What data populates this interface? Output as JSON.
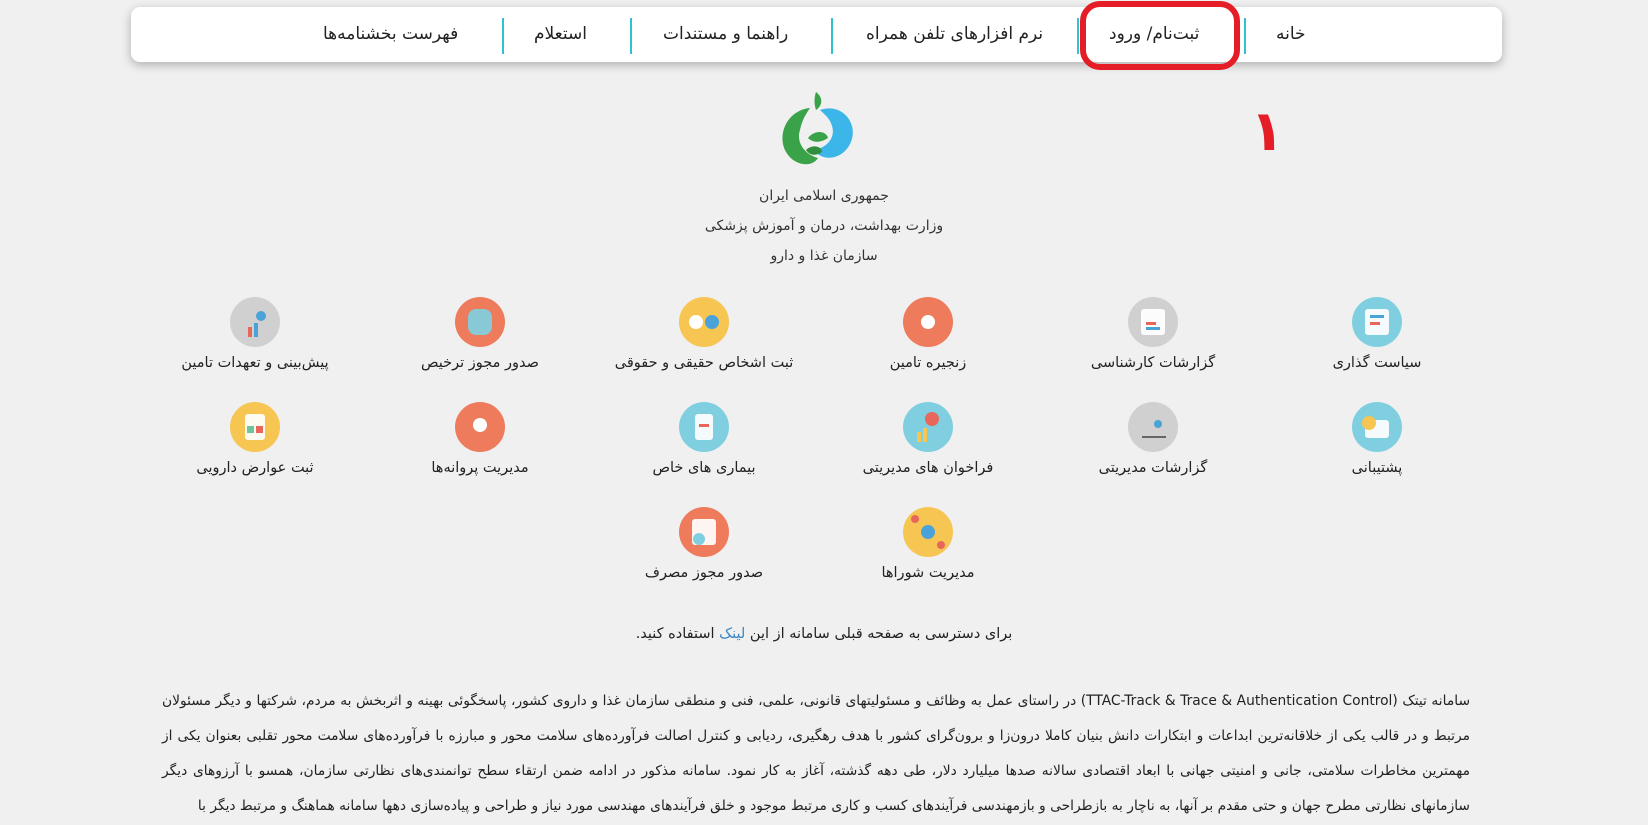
{
  "nav": {
    "items": [
      {
        "label": "خانه"
      },
      {
        "label": "ثبت‌نام/ ورود"
      },
      {
        "label": "نرم افزارهای تلفن همراه"
      },
      {
        "label": "راهنما و مستندات"
      },
      {
        "label": "استعلام"
      },
      {
        "label": "فهرست بخشنامه‌ها"
      }
    ]
  },
  "annotation": {
    "step_number": "۱",
    "color": "#e41d27"
  },
  "header": {
    "line1": "جمهوری اسلامی ایران",
    "line2": "وزارت بهداشت، درمان و آموزش پزشکی",
    "line3": "سازمان غذا و دارو"
  },
  "services": [
    {
      "label": "سیاست گذاری",
      "color": "#7fcfe0",
      "icon": "policy-icon"
    },
    {
      "label": "گزارشات کارشناسی",
      "color": "#d0d0d0",
      "icon": "expert-report-icon"
    },
    {
      "label": "زنجیره تامین",
      "color": "#ee7b5b",
      "icon": "supply-chain-icon"
    },
    {
      "label": "ثبت اشخاص حقیقی و حقوقی",
      "color": "#f6c552",
      "icon": "people-registration-icon"
    },
    {
      "label": "صدور مجوز ترخیص",
      "color": "#ee7b5b",
      "icon": "clearance-permit-icon"
    },
    {
      "label": "پیش‌بینی و تعهدات تامین",
      "color": "#d0d0d0",
      "icon": "forecast-icon"
    },
    {
      "label": "پشتیبانی",
      "color": "#7fcfe0",
      "icon": "support-icon"
    },
    {
      "label": "گزارشات مدیریتی",
      "color": "#d0d0d0",
      "icon": "management-report-icon"
    },
    {
      "label": "فراخوان های مدیریتی",
      "color": "#7fcfe0",
      "icon": "management-call-icon"
    },
    {
      "label": "بیماری های خاص",
      "color": "#7fcfe0",
      "icon": "special-diseases-icon"
    },
    {
      "label": "مدیریت پروانه‌ها",
      "color": "#ee7b5b",
      "icon": "license-management-icon"
    },
    {
      "label": "ثبت عوارض دارویی",
      "color": "#f6c552",
      "icon": "drug-side-effects-icon"
    },
    {
      "label": "مدیریت شوراها",
      "color": "#f6c552",
      "icon": "councils-icon"
    },
    {
      "label": "صدور مجوز مصرف",
      "color": "#ee7b5b",
      "icon": "consumption-permit-icon"
    }
  ],
  "notice": {
    "before": "برای دسترسی به صفحه قبلی سامانه از این ",
    "link": "لینک",
    "after": " استفاده کنید."
  },
  "description": "سامانه تیتک (TTAC-Track & Trace & Authentication Control) در راستای عمل به وظائف و مسئولیتهای قانونی، علمی، فنی و منطقی سازمان غذا و داروی کشور، پاسخگوئی بهینه و اثربخش به مردم، شرکتها و دیگر مسئولان مرتبط و در قالب یکی از خلاقانه‌ترین ابداعات و ابتکارات دانش بنیان کاملا درون‌زا و برون‌گرای کشور با هدف رهگیری، ردیابی و کنترل اصالت فرآورده‌های سلامت محور و مبارزه با فرآورده‌های سلامت محور تقلبی بعنوان یکی از مهمترین مخاطرات سلامتی، جانی و امنیتی جهانی با ابعاد اقتصادی سالانه صدها میلیارد دلار، طی دهه گذشته، آغاز به کار نمود. سامانه مذکور در ادامه ضمن ارتقاء سطح توانمندی‌های نظارتی سازمان، همسو با آرزوهای دیگر سازمانهای نظارتی مطرح جهان و حتی مقدم بر آنها، به ناچار به بازطراحی و بازمهندسی فرآیندهای کسب و کاری مرتبط موجود و خلق فرآیندهای مهندسی مورد نیاز و طراحی و پیاده‌سازی دهها سامانه هماهنگ و مرتبط دیگر با"
}
